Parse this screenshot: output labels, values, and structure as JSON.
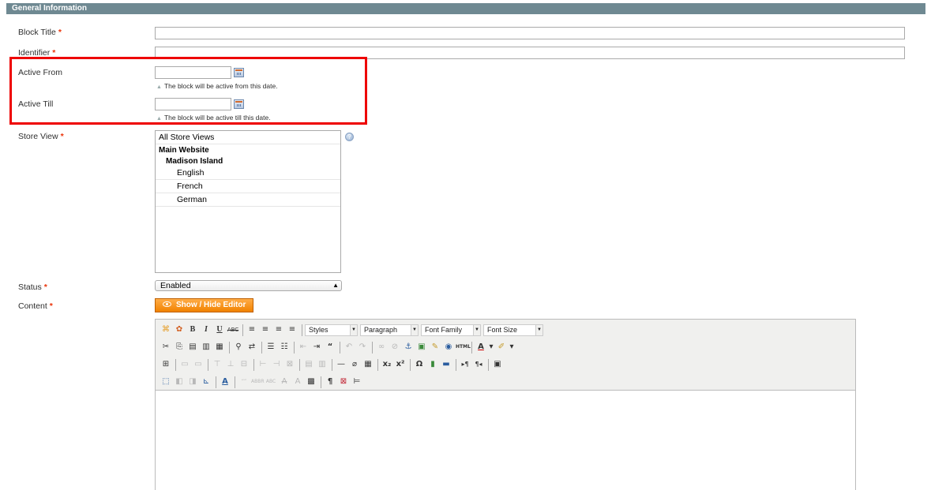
{
  "section": {
    "title": "General Information"
  },
  "fields": {
    "block_title": {
      "label": "Block Title",
      "required": "*",
      "value": ""
    },
    "identifier": {
      "label": "Identifier",
      "required": "*",
      "value": ""
    },
    "active_from": {
      "label": "Active From",
      "value": "",
      "note": "The block will be active from this date."
    },
    "active_till": {
      "label": "Active Till",
      "value": "",
      "note": "The block will be active till this date."
    },
    "store_view": {
      "label": "Store View",
      "required": "*",
      "options": {
        "all": "All Store Views",
        "website": "Main Website",
        "store": "Madison Island",
        "english": "English",
        "french": "French",
        "german": "German"
      }
    },
    "status": {
      "label": "Status",
      "required": "*",
      "value": "Enabled"
    },
    "content": {
      "label": "Content",
      "required": "*",
      "toggle_button": "Show / Hide Editor"
    }
  },
  "editor": {
    "selects": {
      "styles": "Styles",
      "paragraph": "Paragraph",
      "font_family": "Font Family",
      "font_size": "Font Size"
    },
    "html_label": "HTML"
  },
  "colors": {
    "header_bg": "#6f8992",
    "highlight": "#ee0000",
    "button_orange": "#f18200",
    "required": "#eb340a"
  }
}
